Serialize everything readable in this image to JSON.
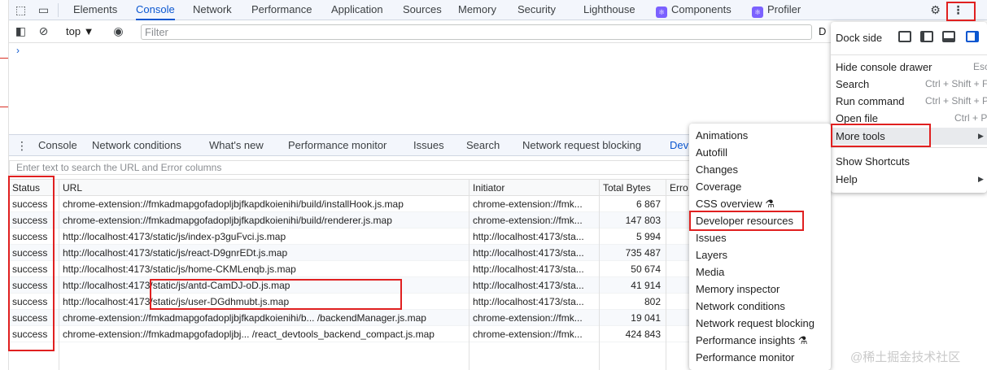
{
  "tabs": [
    "Elements",
    "Console",
    "Network",
    "Performance",
    "Application",
    "Sources",
    "Memory",
    "Security",
    "Lighthouse",
    "Components",
    "Profiler"
  ],
  "active_tab": "Console",
  "toolbar": {
    "context": "top ▼",
    "filter_placeholder": "Filter",
    "cut_label": "D"
  },
  "prompt_glyph": "›",
  "drawer": {
    "tabs": [
      "Console",
      "Network conditions",
      "What's new",
      "Performance monitor",
      "Issues",
      "Search",
      "Network request blocking",
      "Dev"
    ],
    "active_tab": "Dev",
    "search_placeholder": "Enter text to search the URL and Error columns",
    "columns": [
      "Status",
      "URL",
      "Initiator",
      "Total Bytes",
      "Erro"
    ],
    "rows": [
      {
        "status": "success",
        "url": "chrome-extension://fmkadmapgofadopljbjfkapdkoienihi/build/installHook.js.map",
        "initiator": "chrome-extension://fmk...",
        "bytes": "6 867"
      },
      {
        "status": "success",
        "url": "chrome-extension://fmkadmapgofadopljbjfkapdkoienihi/build/renderer.js.map",
        "initiator": "chrome-extension://fmk...",
        "bytes": "147 803"
      },
      {
        "status": "success",
        "url": "http://localhost:4173/static/js/index-p3guFvci.js.map",
        "initiator": "http://localhost:4173/sta...",
        "bytes": "5 994"
      },
      {
        "status": "success",
        "url": "http://localhost:4173/static/js/react-D9gnrEDt.js.map",
        "initiator": "http://localhost:4173/sta...",
        "bytes": "735 487"
      },
      {
        "status": "success",
        "url": "http://localhost:4173/static/js/home-CKMLenqb.js.map",
        "initiator": "http://localhost:4173/sta...",
        "bytes": "50 674"
      },
      {
        "status": "success",
        "url": "http://localhost:4173/static/js/antd-CamDJ-oD.js.map",
        "initiator": "http://localhost:4173/sta...",
        "bytes": "41 914"
      },
      {
        "status": "success",
        "url": "http://localhost:4173/static/js/user-DGdhmubt.js.map",
        "initiator": "http://localhost:4173/sta...",
        "bytes": "802"
      },
      {
        "status": "success",
        "url": "chrome-extension://fmkadmapgofadopljbjfkapdkoienihi/b...  /backendManager.js.map",
        "initiator": "chrome-extension://fmk...",
        "bytes": "19 041"
      },
      {
        "status": "success",
        "url": "chrome-extension://fmkadmapgofadopljbj...  /react_devtools_backend_compact.js.map",
        "initiator": "chrome-extension://fmk...",
        "bytes": "424 843"
      }
    ]
  },
  "menu": {
    "dock_label": "Dock side",
    "items": [
      {
        "label": "Hide console drawer",
        "shortcut": "Esc"
      },
      {
        "label": "Search",
        "shortcut": "Ctrl + Shift + F"
      },
      {
        "label": "Run command",
        "shortcut": "Ctrl + Shift + P"
      },
      {
        "label": "Open file",
        "shortcut": "Ctrl + P"
      },
      {
        "label": "More tools",
        "shortcut": ""
      },
      {
        "label": "Show Shortcuts",
        "shortcut": ""
      },
      {
        "label": "Help",
        "shortcut": ""
      }
    ]
  },
  "submenu": [
    "Animations",
    "Autofill",
    "Changes",
    "Coverage",
    "CSS overview ⚗",
    "Developer resources",
    "Issues",
    "Layers",
    "Media",
    "Memory inspector",
    "Network conditions",
    "Network request blocking",
    "Performance insights ⚗",
    "Performance monitor"
  ],
  "watermark": "@稀土掘金技术社区",
  "colors": {
    "accent": "#0b57d0",
    "highlight": "#e02020"
  },
  "icons": [
    "inspect-icon",
    "device-icon",
    "gear-icon",
    "kebab-menu-icon",
    "sidebar-toggle-icon",
    "clear-icon",
    "eye-icon",
    "drawer-menu-icon",
    "react-icon"
  ]
}
